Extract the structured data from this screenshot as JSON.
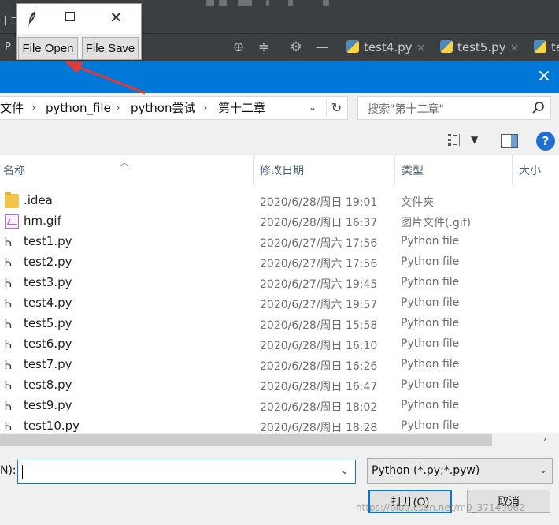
{
  "ide": {
    "left_text_top": "十二",
    "left_text_mid": "P",
    "tabs": [
      {
        "label": "test4.py"
      },
      {
        "label": "test5.py"
      },
      {
        "label": "te"
      }
    ],
    "tab_close": "×"
  },
  "tk_window": {
    "open_label": "File Open",
    "save_label": "File Save"
  },
  "dialog": {
    "close_glyph": "×",
    "breadcrumbs": [
      "文件",
      "python_file",
      "python尝试",
      "第十二章"
    ],
    "crumb_sep": "›",
    "search_placeholder": "搜索\"第十二章\"",
    "columns": {
      "name": "名称",
      "date": "修改日期",
      "type": "类型",
      "size": "大小"
    },
    "files": [
      {
        "name": ".idea",
        "date": "2020/6/28/周日 19:01",
        "type": "文件夹",
        "icon": "folder-icon"
      },
      {
        "name": "hm.gif",
        "date": "2020/6/28/周日 16:37",
        "type": "图片文件(.gif)",
        "icon": "gif-image-icon"
      },
      {
        "name": "test1.py",
        "date": "2020/6/27/周六 17:56",
        "type": "Python file",
        "icon": "python-file-icon"
      },
      {
        "name": "test2.py",
        "date": "2020/6/27/周六 17:56",
        "type": "Python file",
        "icon": "python-file-icon"
      },
      {
        "name": "test3.py",
        "date": "2020/6/27/周六 19:45",
        "type": "Python file",
        "icon": "python-file-icon"
      },
      {
        "name": "test4.py",
        "date": "2020/6/27/周六 19:57",
        "type": "Python file",
        "icon": "python-file-icon"
      },
      {
        "name": "test5.py",
        "date": "2020/6/28/周日 15:58",
        "type": "Python file",
        "icon": "python-file-icon"
      },
      {
        "name": "test6.py",
        "date": "2020/6/28/周日 16:10",
        "type": "Python file",
        "icon": "python-file-icon"
      },
      {
        "name": "test7.py",
        "date": "2020/6/28/周日 16:26",
        "type": "Python file",
        "icon": "python-file-icon"
      },
      {
        "name": "test8.py",
        "date": "2020/6/28/周日 16:47",
        "type": "Python file",
        "icon": "python-file-icon"
      },
      {
        "name": "test9.py",
        "date": "2020/6/28/周日 18:02",
        "type": "Python file",
        "icon": "python-file-icon"
      },
      {
        "name": "test10.py",
        "date": "2020/6/28/周日 18:28",
        "type": "Python file",
        "icon": "python-file-icon"
      }
    ],
    "filename_label": "N):",
    "filename_value": "",
    "filetype_value": "Python (*.py;*.pyw)",
    "open_button": "打开(O)",
    "cancel_button": "取消",
    "help_glyph": "?",
    "watermark": "https://blog.csdn.net/m0_37149062"
  },
  "colors": {
    "accent": "#0078d7",
    "ide_bg": "#3c3f41",
    "annotation_arrow": "#e53935"
  }
}
